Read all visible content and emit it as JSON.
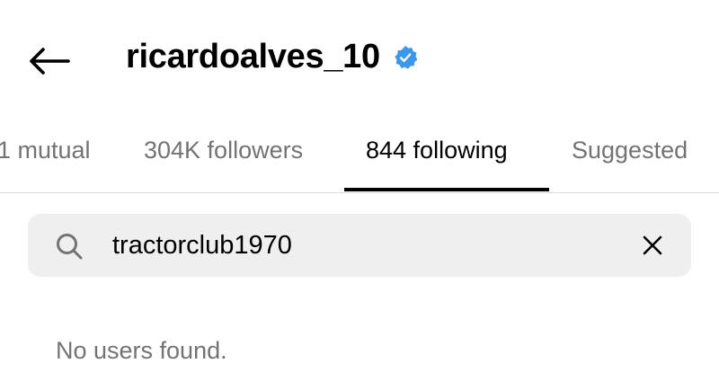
{
  "header": {
    "username": "ricardoalves_10",
    "verified": true,
    "back_icon": "arrow-left-icon",
    "verified_icon": "verified-badge-icon",
    "verified_color": "#3897f0"
  },
  "tabs": [
    {
      "label": "1 mutual",
      "active": false
    },
    {
      "label": "304K followers",
      "active": false
    },
    {
      "label": "844 following",
      "active": true
    },
    {
      "label": "Suggested",
      "active": false
    }
  ],
  "search": {
    "value": "tractorclub1970",
    "search_icon": "search-icon",
    "clear_icon": "close-icon"
  },
  "results": {
    "empty_message": "No users found."
  }
}
